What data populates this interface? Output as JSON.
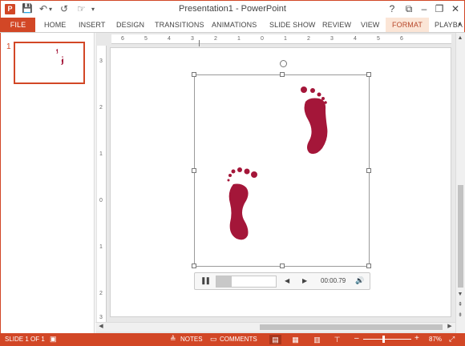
{
  "window": {
    "title": "Presentation1 - PowerPoint",
    "app_icon": "P",
    "help": "?",
    "ribbon_options": "⧉",
    "minimize": "–",
    "restore": "❐",
    "close": "✕"
  },
  "qat": {
    "save_icon": "💾",
    "undo_icon": "↶",
    "undo_dropdown": "▾",
    "redo_icon": "↺",
    "touch_icon": "☞",
    "customize": "▾"
  },
  "ribbon": {
    "tabs": [
      "FILE",
      "HOME",
      "INSERT",
      "DESIGN",
      "TRANSITIONS",
      "ANIMATIONS",
      "SLIDE SHOW",
      "REVIEW",
      "VIEW",
      "FORMAT",
      "PLAYBA"
    ],
    "overflow_arrow": "▸"
  },
  "thumbnails": {
    "slide_number": "1"
  },
  "ruler": {
    "horizontal": [
      "6",
      "5",
      "4",
      "3",
      "2",
      "1",
      "0",
      "1",
      "2",
      "3",
      "4",
      "5",
      "6"
    ],
    "vertical": [
      "3",
      "2",
      "1",
      "0",
      "1",
      "2",
      "3"
    ]
  },
  "media": {
    "pause_icon": "❚❚",
    "progress_fraction": 0.25,
    "back_icon": "◀",
    "forward_icon": "▶",
    "time": "00:00.79",
    "volume_icon": "🔊"
  },
  "scroll": {
    "up": "▲",
    "down": "▼",
    "left": "◀",
    "right": "▶",
    "prev_slide": "⇞",
    "next_slide": "⇟"
  },
  "status": {
    "slide": "SLIDE 1 OF 1",
    "notes": "NOTES",
    "comments": "COMMENTS",
    "zoom_out": "–",
    "zoom_in": "+",
    "zoom": "87%",
    "fit_icon": "⤢"
  },
  "colors": {
    "accent": "#d24726",
    "footprint": "#a41639"
  }
}
